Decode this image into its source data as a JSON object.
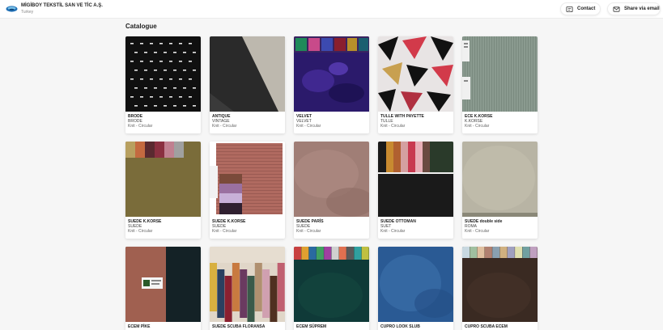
{
  "header": {
    "company_name": "MİGİBOY TEKSTİL SAN VE TİC A.Ş.",
    "country": "Turkey",
    "contact_label": "Contact",
    "share_label": "Share via email"
  },
  "catalogue": {
    "title": "Catalogue",
    "cards": [
      {
        "title": "BRODE",
        "type": "BRODE",
        "knit": "Knit - Circular",
        "pattern": "brode"
      },
      {
        "title": "ANTIQUE",
        "type": "VINTAGE",
        "knit": "Knit - Circular",
        "pattern": "antique"
      },
      {
        "title": "VELVET",
        "type": "VELVET",
        "knit": "Knit - Circular",
        "pattern": "velvet"
      },
      {
        "title": "TULLE WITH PAYETTE",
        "type": "TULLE",
        "knit": "Knit - Circular",
        "pattern": "tulle"
      },
      {
        "title": "ECE K.KORSE",
        "type": "K.KORSE",
        "knit": "Knit - Circular",
        "pattern": "ece"
      },
      {
        "title": "SUEDE K.KORSE",
        "type": "SUEDE",
        "knit": "Knit - Circular",
        "pattern": "suede-khaki"
      },
      {
        "title": "SUEDE K.KORSE",
        "type": "SUEDE",
        "knit": "Knit - Circular",
        "pattern": "suede-rose"
      },
      {
        "title": "SUEDE PARİS",
        "type": "SUEDE",
        "knit": "Knit - Circular",
        "pattern": "suede-paris"
      },
      {
        "title": "SUEDE OTTOMAN",
        "type": "SUET",
        "knit": "Knit - Circular",
        "pattern": "ottoman"
      },
      {
        "title": "SUEDE double side",
        "type": "ROMA",
        "knit": "Knit - Circular",
        "pattern": "double"
      },
      {
        "title": "ECEM PİKE",
        "type": "",
        "knit": "",
        "pattern": "pike"
      },
      {
        "title": "SUEDE SCUBA FLORANSA",
        "type": "",
        "knit": "",
        "pattern": "floransa"
      },
      {
        "title": "ECEM SÜPREM",
        "type": "",
        "knit": "",
        "pattern": "suprem"
      },
      {
        "title": "CUPRO LOOK SLUB",
        "type": "",
        "knit": "",
        "pattern": "cupro"
      },
      {
        "title": "CUPRO SCUBA ECEM",
        "type": "",
        "knit": "",
        "pattern": "cupro-scuba"
      }
    ]
  }
}
